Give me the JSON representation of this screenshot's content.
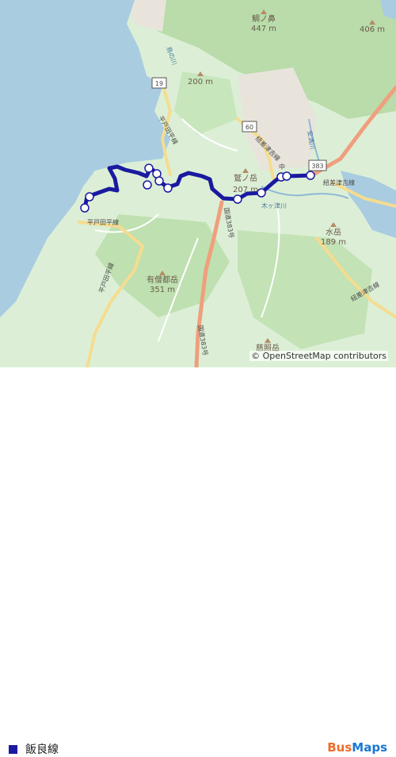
{
  "map": {
    "peaks": [
      {
        "name": "鯛ノ鼻",
        "elev": "447 m"
      },
      {
        "name": "",
        "elev": "406 m"
      },
      {
        "name": "",
        "elev": "200 m"
      },
      {
        "name": "鷲ノ岳",
        "elev": "207 m"
      },
      {
        "name": "水岳",
        "elev": "189 m"
      },
      {
        "name": "有僧都岳",
        "elev": "351 m"
      },
      {
        "name": "慈照岳",
        "elev": ""
      }
    ],
    "route_shields": [
      "19",
      "60",
      "383"
    ],
    "road_labels": [
      "平戸田平線",
      "平戸田平線",
      "平戸田平線",
      "紐差津吉線",
      "紐差津吉線",
      "紐差津吉線",
      "国道383号",
      "国道383号",
      "木ヶ津川",
      "鳥の川",
      "安満川",
      "中"
    ],
    "attribution": "© OpenStreetMap contributors"
  },
  "legend": {
    "color": "#1a1aa0",
    "label": "飯良線"
  },
  "brand": {
    "part1": "Bus",
    "part2": "Maps"
  }
}
